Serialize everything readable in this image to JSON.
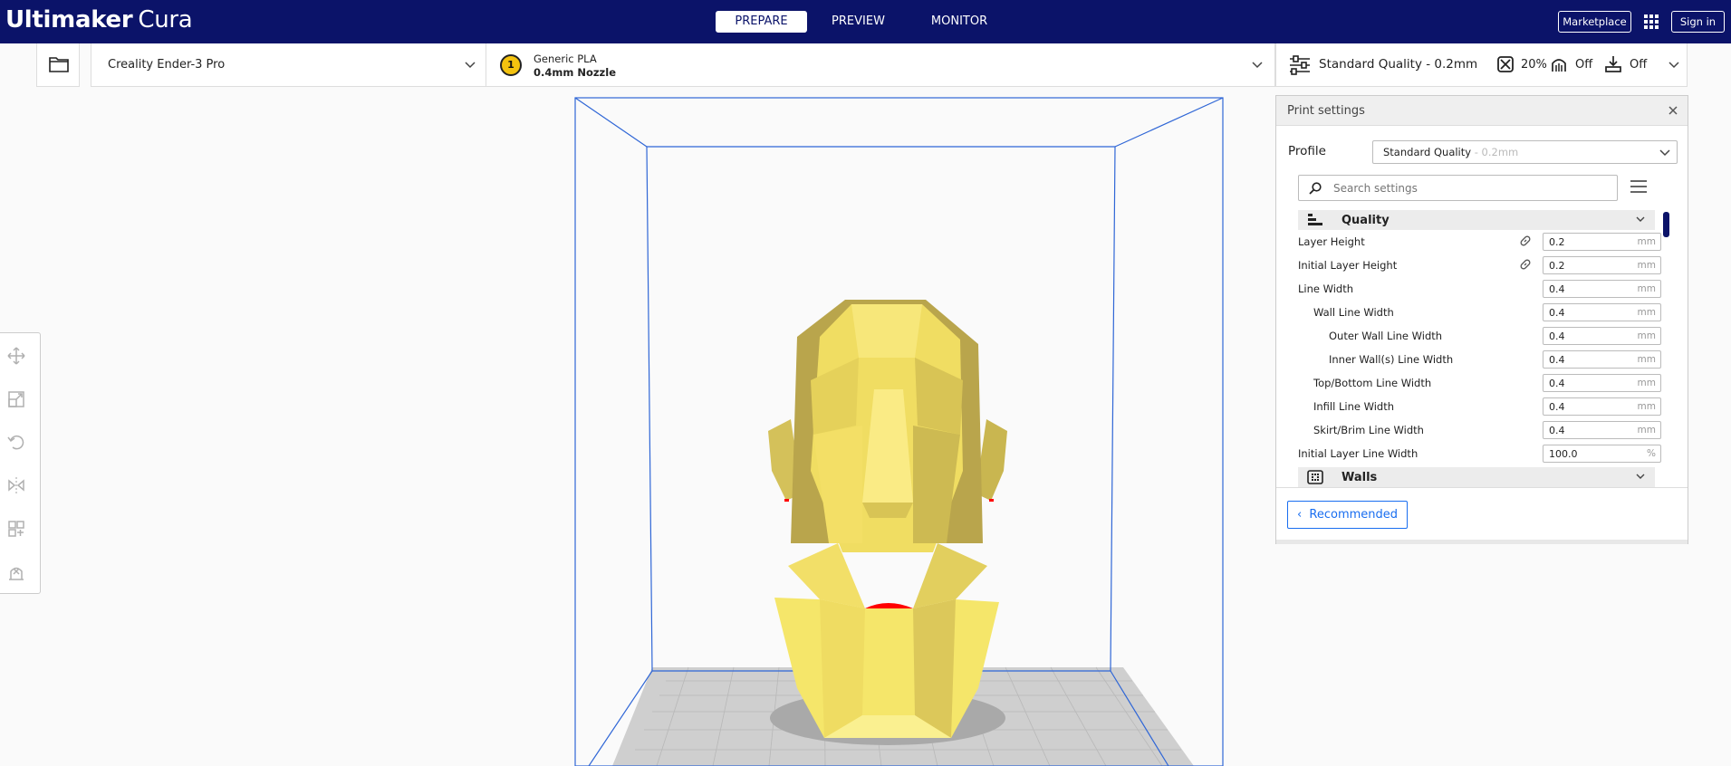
{
  "header": {
    "brand_bold": "Ultimaker",
    "brand_light": "Cura",
    "tabs": [
      {
        "label": "PREPARE",
        "active": true
      },
      {
        "label": "PREVIEW",
        "active": false
      },
      {
        "label": "MONITOR",
        "active": false
      }
    ],
    "marketplace_label": "Marketplace",
    "signin_label": "Sign in",
    "color": "#0b1369"
  },
  "toolbar": {
    "printer_name": "Creality Ender-3 Pro",
    "extruder_number": "1",
    "material_name": "Generic PLA",
    "nozzle_name": "0.4mm Nozzle",
    "quality_summary": "Standard Quality - 0.2mm",
    "infill_value": "20%",
    "support_value": "Off",
    "adhesion_value": "Off"
  },
  "tools": [
    "move-icon",
    "scale-icon",
    "rotate-icon",
    "mirror-icon",
    "per-model-settings-icon",
    "support-blocker-icon"
  ],
  "settings_panel": {
    "title": "Print settings",
    "profile_label": "Profile",
    "profile_value": "Standard Quality",
    "profile_suffix": " - 0.2mm",
    "search_placeholder": "Search settings",
    "categories": [
      {
        "label": "Quality",
        "icon": "quality-icon"
      },
      {
        "label": "Walls",
        "icon": "walls-icon"
      }
    ],
    "quality_settings": [
      {
        "label": "Layer Height",
        "value": "0.2",
        "unit": "mm",
        "linked": true,
        "indent": 0
      },
      {
        "label": "Initial Layer Height",
        "value": "0.2",
        "unit": "mm",
        "linked": true,
        "indent": 0
      },
      {
        "label": "Line Width",
        "value": "0.4",
        "unit": "mm",
        "linked": false,
        "indent": 0
      },
      {
        "label": "Wall Line Width",
        "value": "0.4",
        "unit": "mm",
        "linked": false,
        "indent": 1
      },
      {
        "label": "Outer Wall Line Width",
        "value": "0.4",
        "unit": "mm",
        "linked": false,
        "indent": 2
      },
      {
        "label": "Inner Wall(s) Line Width",
        "value": "0.4",
        "unit": "mm",
        "linked": false,
        "indent": 2
      },
      {
        "label": "Top/Bottom Line Width",
        "value": "0.4",
        "unit": "mm",
        "linked": false,
        "indent": 1
      },
      {
        "label": "Infill Line Width",
        "value": "0.4",
        "unit": "mm",
        "linked": false,
        "indent": 1
      },
      {
        "label": "Skirt/Brim Line Width",
        "value": "0.4",
        "unit": "mm",
        "linked": false,
        "indent": 1
      },
      {
        "label": "Initial Layer Line Width",
        "value": "100.0",
        "unit": "%",
        "linked": false,
        "indent": 0
      }
    ],
    "recommended_label": "Recommended"
  },
  "model": {
    "color": "#f5e66a",
    "overhang_color": "#ff0000",
    "build_volume_color": "#2f66d6"
  }
}
